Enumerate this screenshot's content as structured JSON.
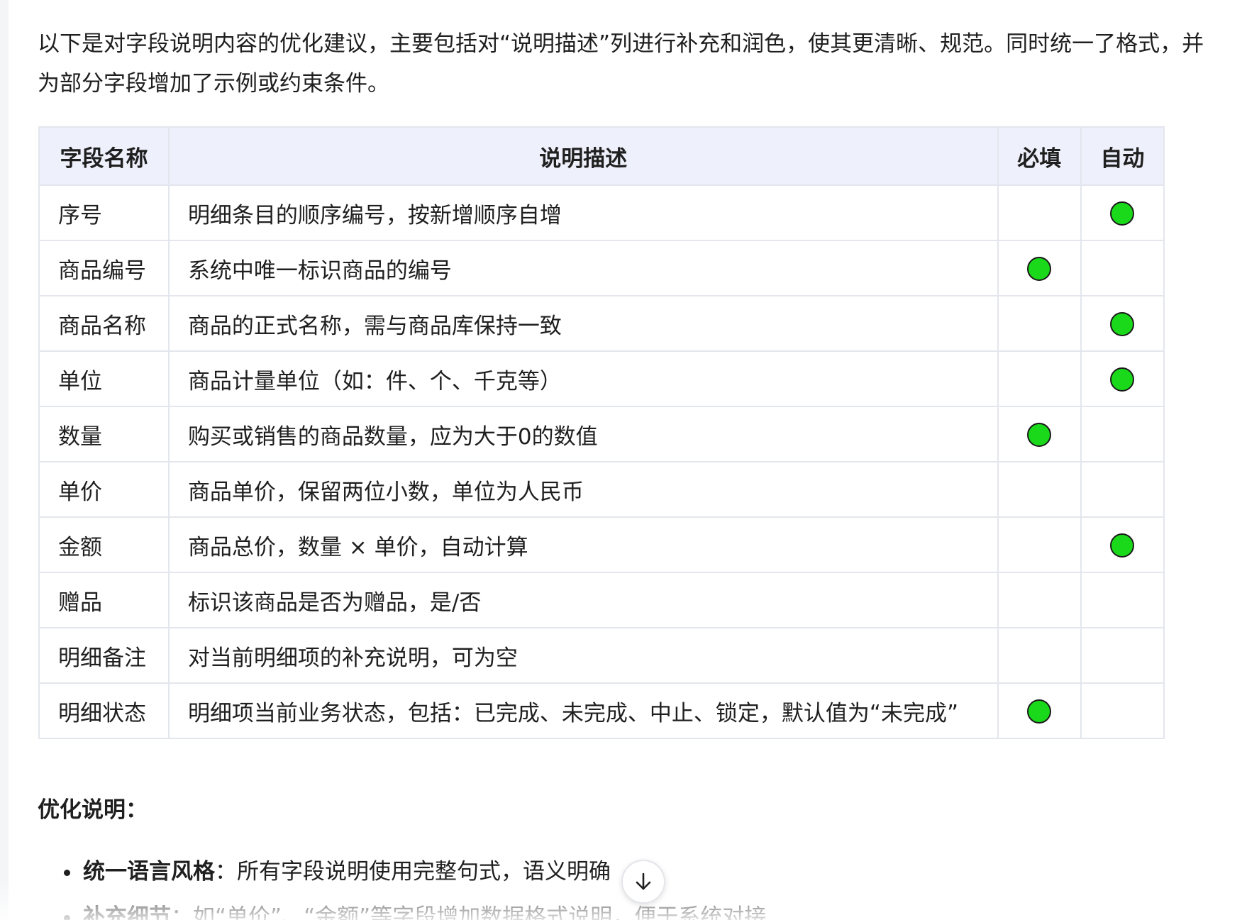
{
  "intro": {
    "line1": "以下是对字段说明内容的优化建议，主要包括对“说明描述”列进行补充和润色，使其更清晰、规范。同时统一了格式，并",
    "line2": "为部分字段增加了示例或约束条件。"
  },
  "table": {
    "headers": {
      "name": "字段名称",
      "desc": "说明描述",
      "required": "必填",
      "auto": "自动"
    },
    "indicator_color": "#1ad91a",
    "rows": [
      {
        "name": "序号",
        "desc": "明细条目的顺序编号，按新增顺序自增",
        "required": false,
        "auto": true
      },
      {
        "name": "商品编号",
        "desc": "系统中唯一标识商品的编号",
        "required": true,
        "auto": false
      },
      {
        "name": "商品名称",
        "desc": "商品的正式名称，需与商品库保持一致",
        "required": false,
        "auto": true
      },
      {
        "name": "单位",
        "desc": "商品计量单位（如：件、个、千克等）",
        "required": false,
        "auto": true
      },
      {
        "name": "数量",
        "desc": "购买或销售的商品数量，应为大于0的数值",
        "required": true,
        "auto": false
      },
      {
        "name": "单价",
        "desc": "商品单价，保留两位小数，单位为人民币",
        "required": false,
        "auto": false
      },
      {
        "name": "金额",
        "desc": "商品总价，数量 × 单价，自动计算",
        "required": false,
        "auto": true
      },
      {
        "name": "赠品",
        "desc": "标识该商品是否为赠品，是/否",
        "required": false,
        "auto": false
      },
      {
        "name": "明细备注",
        "desc": "对当前明细项的补充说明，可为空",
        "required": false,
        "auto": false
      },
      {
        "name": "明细状态",
        "desc": "明细项当前业务状态，包括：已完成、未完成、中止、锁定，默认值为“未完成”",
        "required": true,
        "auto": false
      }
    ]
  },
  "notes": {
    "title": "优化说明：",
    "bullets": [
      {
        "bold": "统一语言风格",
        "text": "：所有字段说明使用完整句式，语义明确"
      },
      {
        "bold": "补充细节",
        "text": "：如“单价”、“金额”等字段增加数据格式说明，便于系统对接"
      }
    ]
  },
  "scroll_button": {
    "icon": "arrow-down-icon"
  }
}
